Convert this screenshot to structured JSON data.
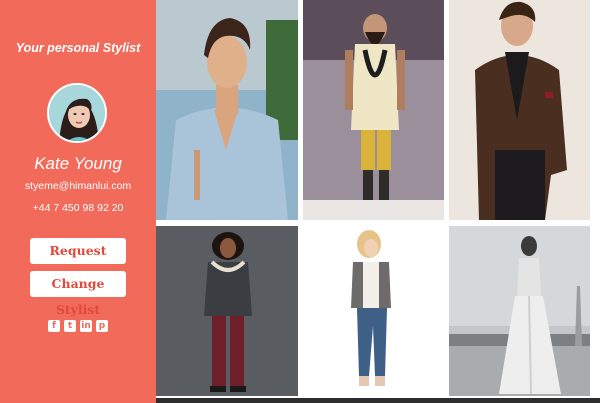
{
  "profile": {
    "tagline": "Your personal Stylist",
    "name": "Kate Young",
    "email": "styeme@himanlui.com",
    "phone": "+44 7 450 98 92 20"
  },
  "buttons": {
    "request": "Request",
    "change_stylist": "Change Stylist"
  },
  "social": [
    {
      "icon": "facebook-icon",
      "glyph": "f"
    },
    {
      "icon": "twitter-icon",
      "glyph": "t"
    },
    {
      "icon": "linkedin-icon",
      "glyph": "in"
    },
    {
      "icon": "pinterest-icon",
      "glyph": "p"
    }
  ],
  "colors": {
    "sidebar": "#f26a5a",
    "button_text": "#e0493a"
  },
  "gallery": [
    {
      "name": "photo-man-denim-shirt"
    },
    {
      "name": "photo-runway-bearded-man"
    },
    {
      "name": "photo-man-brown-blazer"
    },
    {
      "name": "photo-woman-sweater-printed-pants"
    },
    {
      "name": "photo-woman-jeans-fur-vest"
    },
    {
      "name": "photo-woman-bw-gown"
    }
  ]
}
